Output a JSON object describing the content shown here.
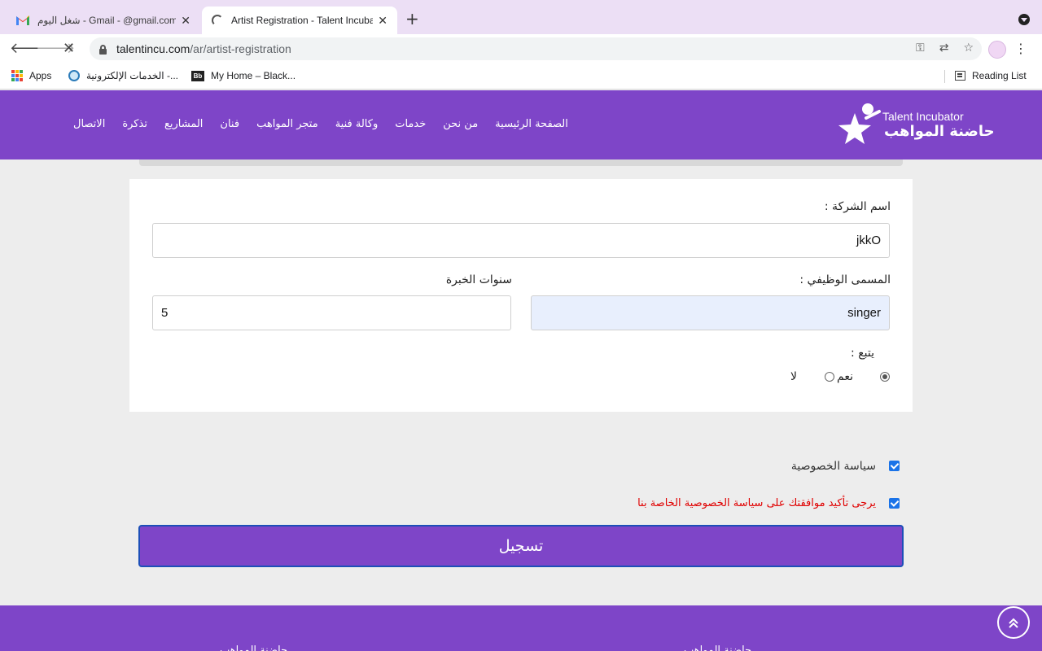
{
  "browser": {
    "tabs": [
      {
        "title": "شغل اليوم - Gmail - @gmail.com"
      },
      {
        "title": "Artist Registration - Talent Incubator"
      }
    ],
    "new_tab": "+",
    "url_host": "talentincu.com",
    "url_path": "/ar/artist-registration",
    "bookmarks": [
      {
        "label": "Apps"
      },
      {
        "label": "الخدمات الإلكترونية -..."
      },
      {
        "label": "My Home – Black..."
      }
    ],
    "reading_list": "Reading List"
  },
  "site": {
    "logo_en": "Talent Incubator",
    "logo_ar": "حاضنة المواهب",
    "nav": [
      "الصفحة الرئيسية",
      "من نحن",
      "خدمات",
      "وكالة فنية",
      "متجر المواهب",
      "فنان",
      "المشاريع",
      "تذكرة",
      "الاتصال"
    ]
  },
  "form": {
    "company_label": "اسم الشركة :",
    "company_value": "jkkO",
    "job_title_label": "المسمى الوظيفي :",
    "job_title_value": "singer",
    "experience_label": "سنوات الخبرة",
    "experience_value": "5",
    "follows_label": "يتبع :",
    "options": [
      "نعم",
      "لا"
    ],
    "privacy_label": "سياسة الخصوصية",
    "privacy_confirm": "يرجى تأكيد موافقتك على سياسة الخصوصية الخاصة بنا",
    "submit_label": "تسجيل"
  },
  "footer": {
    "col1": "حاضنة المواهب",
    "col2": "حاضنة المواهب"
  },
  "colors": {
    "brand": "#7e45c8",
    "error": "#e00000",
    "checkbox": "#1a73e8"
  },
  "icons": [
    "gmail-icon",
    "spinner-icon",
    "close-icon",
    "lock-icon",
    "key-icon",
    "translate-icon",
    "star-icon",
    "apps-icon",
    "globe-icon",
    "reading-list-icon",
    "chevron-up-icon"
  ]
}
